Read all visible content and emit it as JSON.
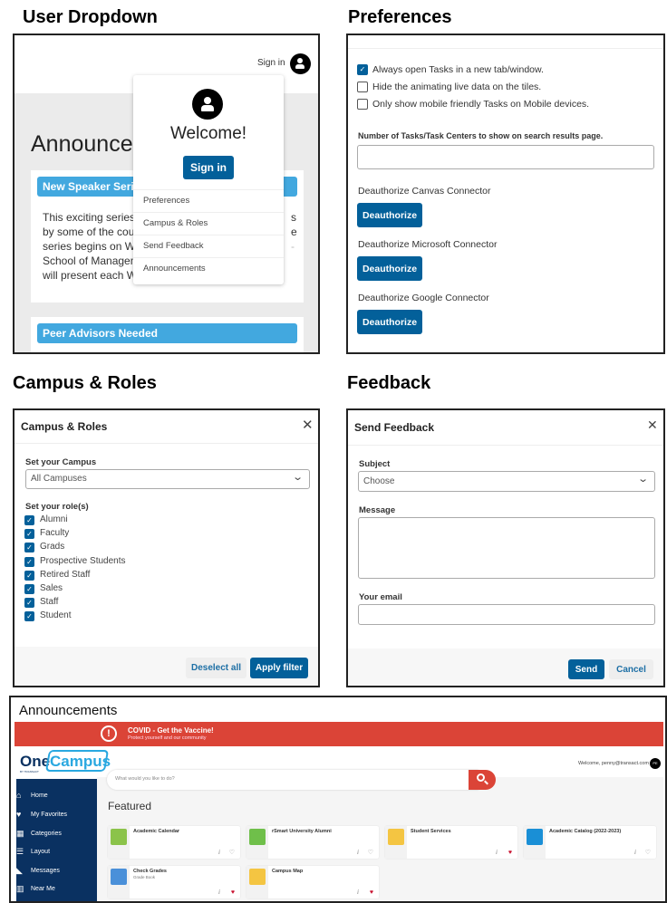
{
  "sections": {
    "user_dropdown": "User Dropdown",
    "preferences": "Preferences",
    "campus_roles": "Campus & Roles",
    "feedback": "Feedback"
  },
  "dropdown": {
    "sign_in_link": "Sign in",
    "welcome": "Welcome!",
    "sign_in_button": "Sign in",
    "menu": [
      "Preferences",
      "Campus & Roles",
      "Send Feedback",
      "Announcements"
    ],
    "page_heading": "Announcem",
    "card1_title": "New Speaker Series",
    "card1_lines": [
      "This exciting series w",
      "by some of the count",
      "series begins on We",
      "School of Manageme",
      "will present each We"
    ],
    "card1_right_fragments": [
      "s",
      "e",
      "-"
    ],
    "card2_title": "Peer Advisors Needed"
  },
  "preferences": {
    "options": [
      {
        "label": "Always open Tasks in a new tab/window.",
        "checked": true
      },
      {
        "label": "Hide the animating live data on the tiles.",
        "checked": false
      },
      {
        "label": "Only show mobile friendly Tasks on Mobile devices.",
        "checked": false
      }
    ],
    "count_label": "Number of Tasks/Task Centers to show on search results page.",
    "count_value": "",
    "connectors": [
      {
        "label": "Deauthorize Canvas Connector",
        "button": "Deauthorize"
      },
      {
        "label": "Deauthorize Microsoft Connector",
        "button": "Deauthorize"
      },
      {
        "label": "Deauthorize Google Connector",
        "button": "Deauthorize"
      }
    ]
  },
  "campus": {
    "title": "Campus & Roles",
    "campus_label": "Set your Campus",
    "campus_value": "All Campuses",
    "roles_label": "Set your role(s)",
    "roles": [
      "Alumni",
      "Faculty",
      "Grads",
      "Prospective Students",
      "Retired Staff",
      "Sales",
      "Staff",
      "Student"
    ],
    "deselect": "Deselect all",
    "apply": "Apply filter"
  },
  "feedback": {
    "title": "Send Feedback",
    "subject_label": "Subject",
    "subject_value": "Choose",
    "message_label": "Message",
    "email_label": "Your email",
    "send": "Send",
    "cancel": "Cancel"
  },
  "announcements": {
    "title": "Announcements",
    "banner_title": "COVID - Get the Vaccine!",
    "banner_sub": "Protect yourself and our community",
    "logo_one": "One",
    "logo_campus": "Campus",
    "logo_by": "BY TRANSACT",
    "welcome": "Welcome, penny@transact.com",
    "avatar_initials": "PE",
    "search_placeholder": "What would you like to do?",
    "nav": [
      "Home",
      "My Favorites",
      "Categories",
      "Layout",
      "Messages",
      "Near Me"
    ],
    "featured": "Featured",
    "cards": [
      {
        "title": "Academic Calendar",
        "sub": "",
        "favorite": false
      },
      {
        "title": "rSmart University Alumni",
        "sub": "",
        "favorite": false
      },
      {
        "title": "Student Services",
        "sub": "",
        "favorite": true
      },
      {
        "title": "Academic Catalog (2022-2023)",
        "sub": "",
        "favorite": false
      },
      {
        "title": "Check Grades",
        "sub": "Grade Book",
        "favorite": true
      },
      {
        "title": "Campus Map",
        "sub": "",
        "favorite": true
      }
    ],
    "colors": {
      "banner": "#db4437",
      "sidebar": "#0a3161",
      "accent": "#03609a"
    }
  }
}
